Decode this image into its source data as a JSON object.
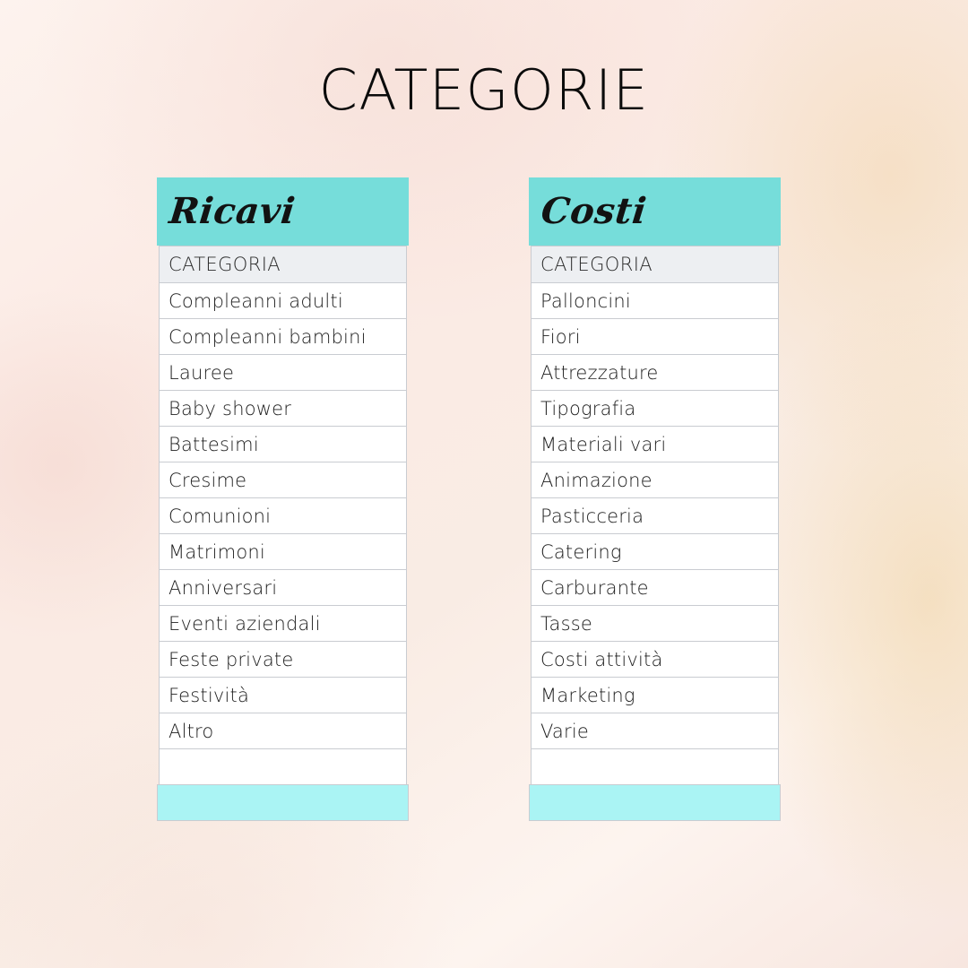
{
  "page": {
    "title": "CATEGORIE",
    "background_style": "pink-gold-marble",
    "colors": {
      "banner": "#76DDDA",
      "footer": "#AAF4F4",
      "column_header_bg": "#EDEFF2",
      "row_bg": "#FFFFFF",
      "border": "#C9CCD1",
      "text": "#1D1D1D",
      "title_text": "#0B0B0B"
    }
  },
  "tables": [
    {
      "id": "ricavi",
      "banner_label": "Ricavi",
      "column_header": "CATEGORIA",
      "rows": [
        "Compleanni adulti",
        "Compleanni bambini",
        "Lauree",
        "Baby shower",
        "Battesimi",
        "Cresime",
        "Comunioni",
        "Matrimoni",
        "Anniversari",
        "Eventi aziendali",
        "Feste private",
        "Festività",
        "Altro",
        ""
      ]
    },
    {
      "id": "costi",
      "banner_label": "Costi",
      "column_header": "CATEGORIA",
      "rows": [
        "Palloncini",
        "Fiori",
        "Attrezzature",
        "Tipografia",
        "Materiali vari",
        "Animazione",
        "Pasticceria",
        "Catering",
        "Carburante",
        "Tasse",
        "Costi attività",
        "Marketing",
        "Varie",
        ""
      ]
    }
  ]
}
